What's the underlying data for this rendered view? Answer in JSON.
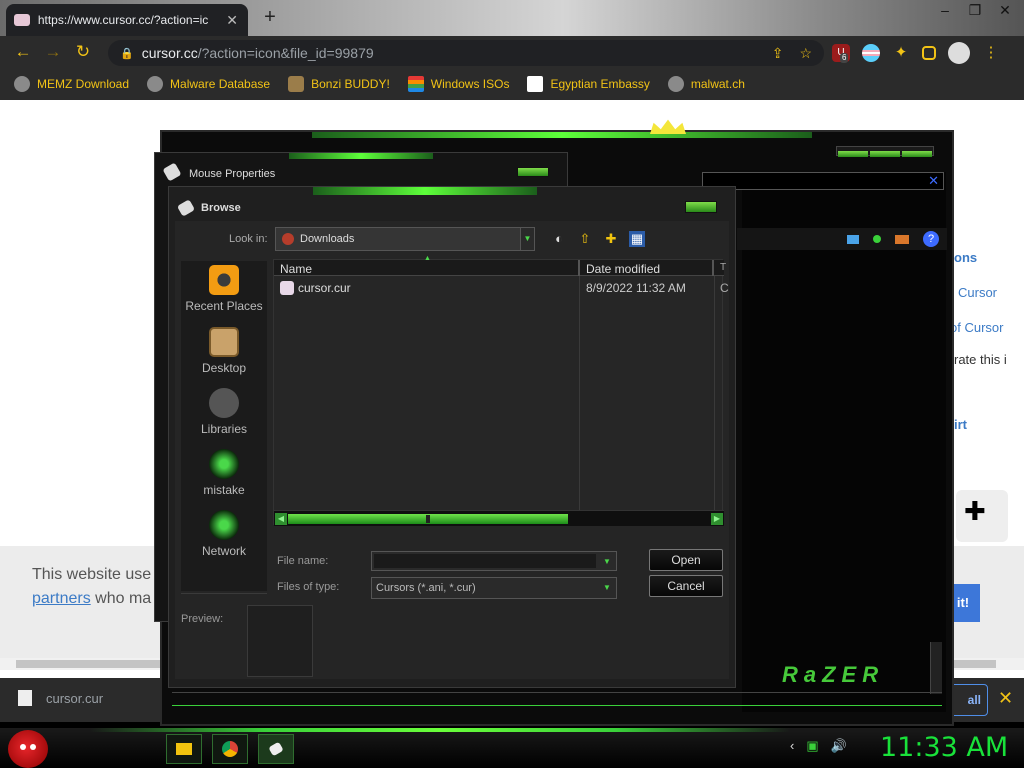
{
  "browser": {
    "tab_title": "https://www.cursor.cc/?action=ic",
    "url_host": "cursor.cc",
    "url_path": "/?action=icon&file_id=99879",
    "ext_badge": "6",
    "bookmarks": [
      {
        "label": "MEMZ Download",
        "icon": "globe-icon"
      },
      {
        "label": "Malware Database",
        "icon": "globe-icon"
      },
      {
        "label": "Bonzi BUDDY!",
        "icon": "bonzi-icon"
      },
      {
        "label": "Windows ISOs",
        "icon": "windows-flag-icon"
      },
      {
        "label": "Egyptian Embassy",
        "icon": "wix-icon"
      },
      {
        "label": "malwat.ch",
        "icon": "globe-icon"
      }
    ]
  },
  "page": {
    "link1": "ons",
    "link2": "Cursor",
    "link3": "of Cursor",
    "text1": "rate this i",
    "link4": "irt",
    "consent_line1": "This website use",
    "consent_partners": "partners",
    "consent_line2_rest": " who ma",
    "gotit": "it!"
  },
  "downloads": {
    "file": "cursor.cur",
    "show_all": "all"
  },
  "mouse_properties": {
    "title": "Mouse Properties"
  },
  "browse": {
    "title": "Browse",
    "look_in_label": "Look in:",
    "look_in_value": "Downloads",
    "places": [
      {
        "label": "Recent Places",
        "icon": "recent-places-icon"
      },
      {
        "label": "Desktop",
        "icon": "desktop-icon"
      },
      {
        "label": "Libraries",
        "icon": "libraries-icon"
      },
      {
        "label": "mistake",
        "icon": "user-folder-icon"
      },
      {
        "label": "Network",
        "icon": "network-icon"
      }
    ],
    "columns": {
      "name": "Name",
      "date": "Date modified",
      "type": "T"
    },
    "files": [
      {
        "name": "cursor.cur",
        "date": "8/9/2022 11:32 AM",
        "type": "C"
      }
    ],
    "file_name_label": "File name:",
    "file_name_value": "",
    "files_of_type_label": "Files of type:",
    "files_of_type_value": "Cursors (*.ani, *.cur)",
    "open_label": "Open",
    "cancel_label": "Cancel",
    "preview_label": "Preview:"
  },
  "razer": {
    "logo_text": "RaZER"
  },
  "taskbar": {
    "time": "11:33 AM"
  },
  "colors": {
    "accent_green": "#3ad13a",
    "chrome_yellow": "#f2c316",
    "clock_green": "#19e23a"
  }
}
